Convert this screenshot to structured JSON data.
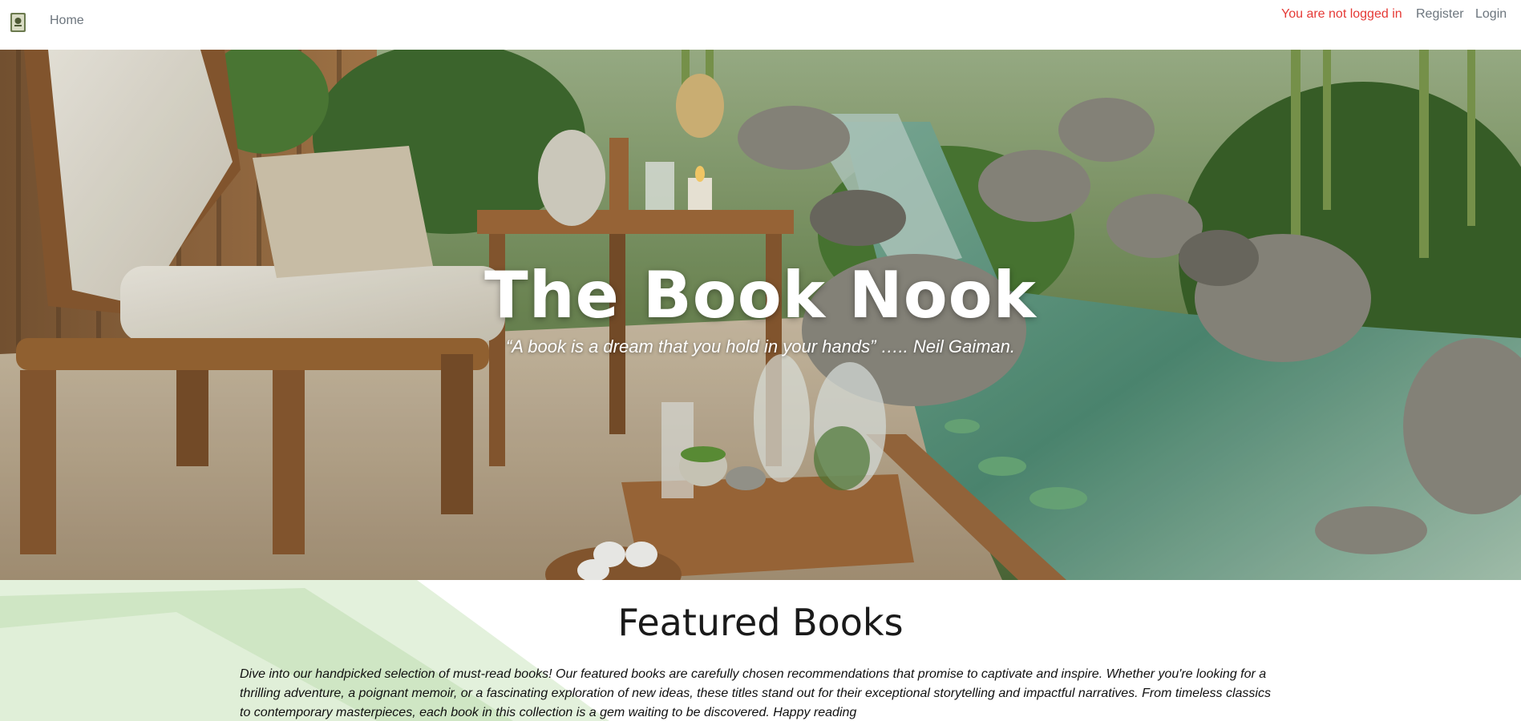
{
  "nav": {
    "home_label": "Home",
    "status_text": "You are not logged in",
    "register_label": "Register",
    "login_label": "Login",
    "logo_icon": "book-logo-icon"
  },
  "hero": {
    "title": "The Book Nook",
    "quote": "“A book is a dream that you hold in your hands” ….. Neil Gaiman."
  },
  "featured": {
    "heading": "Featured Books",
    "description": "Dive into our handpicked selection of must-read books! Our featured books are carefully chosen recommendations that promise to captivate and inspire. Whether you're looking for a thrilling adventure, a poignant memoir, or a fascinating exploration of new ideas, these titles stand out for their exceptional storytelling and impactful narratives. From timeless classics to contemporary masterpieces, each book in this collection is a gem waiting to be discovered. Happy reading"
  },
  "colors": {
    "status_red": "#e53935",
    "nav_gray": "#6c757d",
    "hero_text": "#ffffff",
    "wash_green": "#cfe6c4"
  }
}
